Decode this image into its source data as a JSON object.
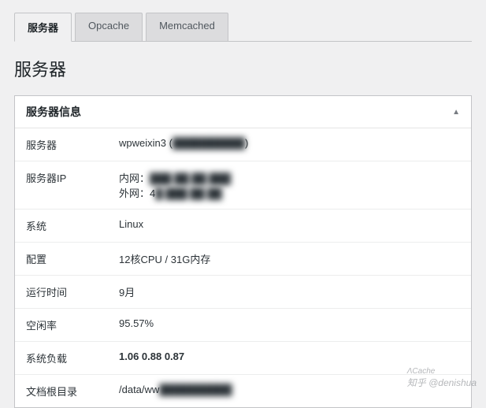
{
  "tabs": [
    {
      "label": "服务器",
      "active": true
    },
    {
      "label": "Opcache",
      "active": false
    },
    {
      "label": "Memcached",
      "active": false
    }
  ],
  "page_title": "服务器",
  "panel": {
    "title": "服务器信息",
    "rows": {
      "server_name": {
        "label": "服务器",
        "value": "wpweixin3 (",
        "redacted": "██████████",
        "tail": ")"
      },
      "server_ip": {
        "label": "服务器IP",
        "internal_label": "内网：",
        "internal_value": "███.██.██.███",
        "external_label": "外网：",
        "external_prefix": "4",
        "external_value": "█.███.██.██"
      },
      "os": {
        "label": "系统",
        "value": "Linux"
      },
      "config": {
        "label": "配置",
        "value": "12核CPU  /  31G内存"
      },
      "uptime": {
        "label": "运行时间",
        "value": "9月"
      },
      "idle": {
        "label": "空闲率",
        "value": "95.57%"
      },
      "load": {
        "label": "系统负载",
        "value": "1.06  0.88  0.87"
      },
      "docroot": {
        "label": "文档根目录",
        "prefix": "/data/ww",
        "redacted": "██████████"
      }
    }
  },
  "watermark": {
    "brand": "ΛCache",
    "handle": "知乎 @denishua"
  }
}
